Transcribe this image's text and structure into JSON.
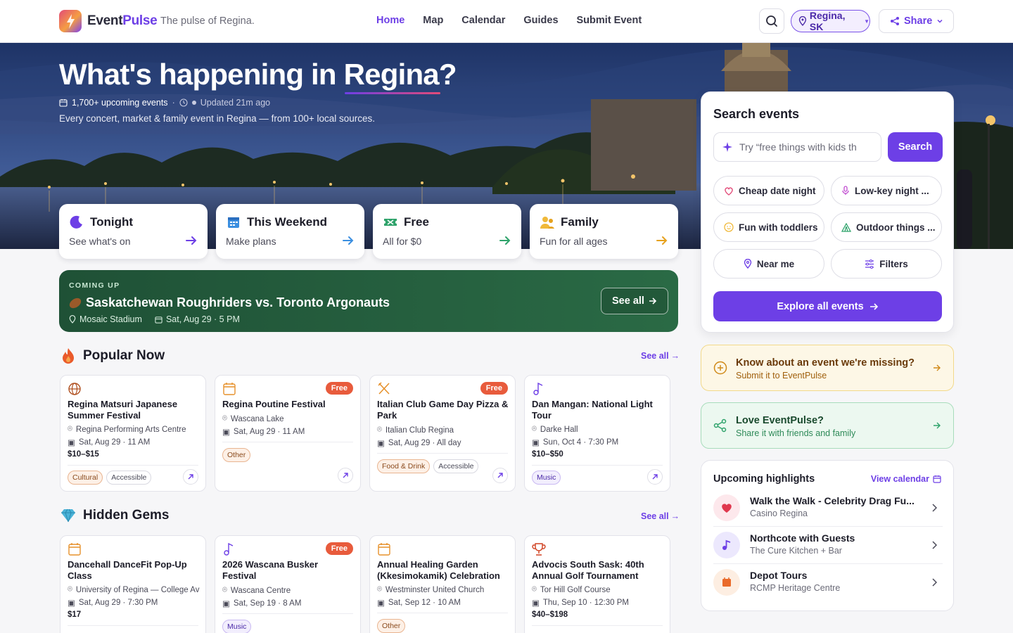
{
  "header": {
    "brand_a": "Event",
    "brand_b": "Pulse",
    "tagline": "The pulse of Regina.",
    "nav": [
      "Home",
      "Map",
      "Calendar",
      "Guides",
      "Submit Event"
    ],
    "city": "Regina, SK",
    "share": "Share"
  },
  "hero": {
    "title_a": "What's happening in ",
    "title_b": "Regina?",
    "count": "1,700+ upcoming events",
    "updated": "Updated 21m ago",
    "subtitle": "Every concert, market & family event in Regina — from 100+ local sources."
  },
  "quick": [
    {
      "title": "Tonight",
      "sub": "See what's on",
      "color": "#6d3fe6",
      "icon": "moon-icon"
    },
    {
      "title": "This Weekend",
      "sub": "Make plans",
      "color": "#3b8fe0",
      "icon": "calendar-icon"
    },
    {
      "title": "Free",
      "sub": "All for $0",
      "color": "#2fa36b",
      "icon": "ticket-icon"
    },
    {
      "title": "Family",
      "sub": "Fun for all ages",
      "color": "#e6a11d",
      "icon": "family-icon"
    }
  ],
  "coming": {
    "label": "COMING UP",
    "title": "Saskatchewan Roughriders vs. Toronto Argonauts",
    "venue": "Mosaic Stadium",
    "date": "Sat, Aug 29 · 5 PM",
    "see_all": "See all"
  },
  "popular": {
    "heading": "Popular Now",
    "see_all": "See all",
    "events": [
      {
        "title": "Regina Matsuri Japanese Summer Festival",
        "venue": "Regina Performing Arts Centre",
        "date": "Sat, Aug 29 · 11 AM",
        "price": "$10–$15",
        "tags": [
          "Cultural",
          "Accessible"
        ]
      },
      {
        "title": "Regina Poutine Festival",
        "venue": "Wascana Lake",
        "date": "Sat, Aug 29 · 11 AM",
        "price": "",
        "free": "Free",
        "tags": [
          "Other"
        ]
      },
      {
        "title": "Italian Club Game Day Pizza & Park",
        "venue": "Italian Club Regina",
        "date": "Sat, Aug 29 · All day",
        "price": "",
        "free": "Free",
        "tags": [
          "Food & Drink",
          "Accessible"
        ]
      },
      {
        "title": "Dan Mangan: National Light Tour",
        "venue": "Darke Hall",
        "date": "Sun, Oct 4 · 7:30 PM",
        "price": "$10–$50",
        "tags": [
          "Music"
        ]
      }
    ]
  },
  "gems": {
    "heading": "Hidden Gems",
    "see_all": "See all",
    "events": [
      {
        "title": "Dancehall DanceFit Pop-Up Class",
        "venue": "University of Regina — College Avenue",
        "date": "Sat, Aug 29 · 7:30 PM",
        "price": "$17"
      },
      {
        "title": "2026 Wascana Busker Festival",
        "venue": "Wascana Centre",
        "date": "Sat, Sep 19 · 8 AM",
        "free": "Free",
        "tags": [
          "Music"
        ]
      },
      {
        "title": "Annual Healing Garden (Kkesimokamik) Celebration",
        "venue": "Westminster United Church",
        "date": "Sat, Sep 12 · 10 AM",
        "tags": [
          "Other"
        ]
      },
      {
        "title": "Advocis South Sask: 40th Annual Golf Tournament",
        "venue": "Tor Hill Golf Course",
        "date": "Thu, Sep 10 · 12:30 PM",
        "price": "$40–$198"
      }
    ]
  },
  "search": {
    "heading": "Search events",
    "placeholder": "Try “free things with kids th",
    "button": "Search",
    "chips": [
      "Cheap date night",
      "Low-key night ...",
      "Fun with toddlers",
      "Outdoor things ...",
      "Near me",
      "Filters"
    ],
    "explore": "Explore all events"
  },
  "promo_missing": {
    "title": "Know about an event we're missing?",
    "sub": "Submit it to EventPulse"
  },
  "promo_love": {
    "title": "Love EventPulse?",
    "sub": "Share it with friends and family"
  },
  "highlights": {
    "heading": "Upcoming highlights",
    "view": "View calendar",
    "items": [
      {
        "title": "Walk the Walk - Celebrity Drag Fu...",
        "sub": "Casino Regina"
      },
      {
        "title": "Northcote with Guests",
        "sub": "The Cure Kitchen + Bar"
      },
      {
        "title": "Depot Tours",
        "sub": "RCMP Heritage Centre"
      }
    ]
  },
  "colors": {
    "accent": "#6d3fe6",
    "free_badge": "#e85b3c",
    "coming_bg": "#1f5136"
  }
}
